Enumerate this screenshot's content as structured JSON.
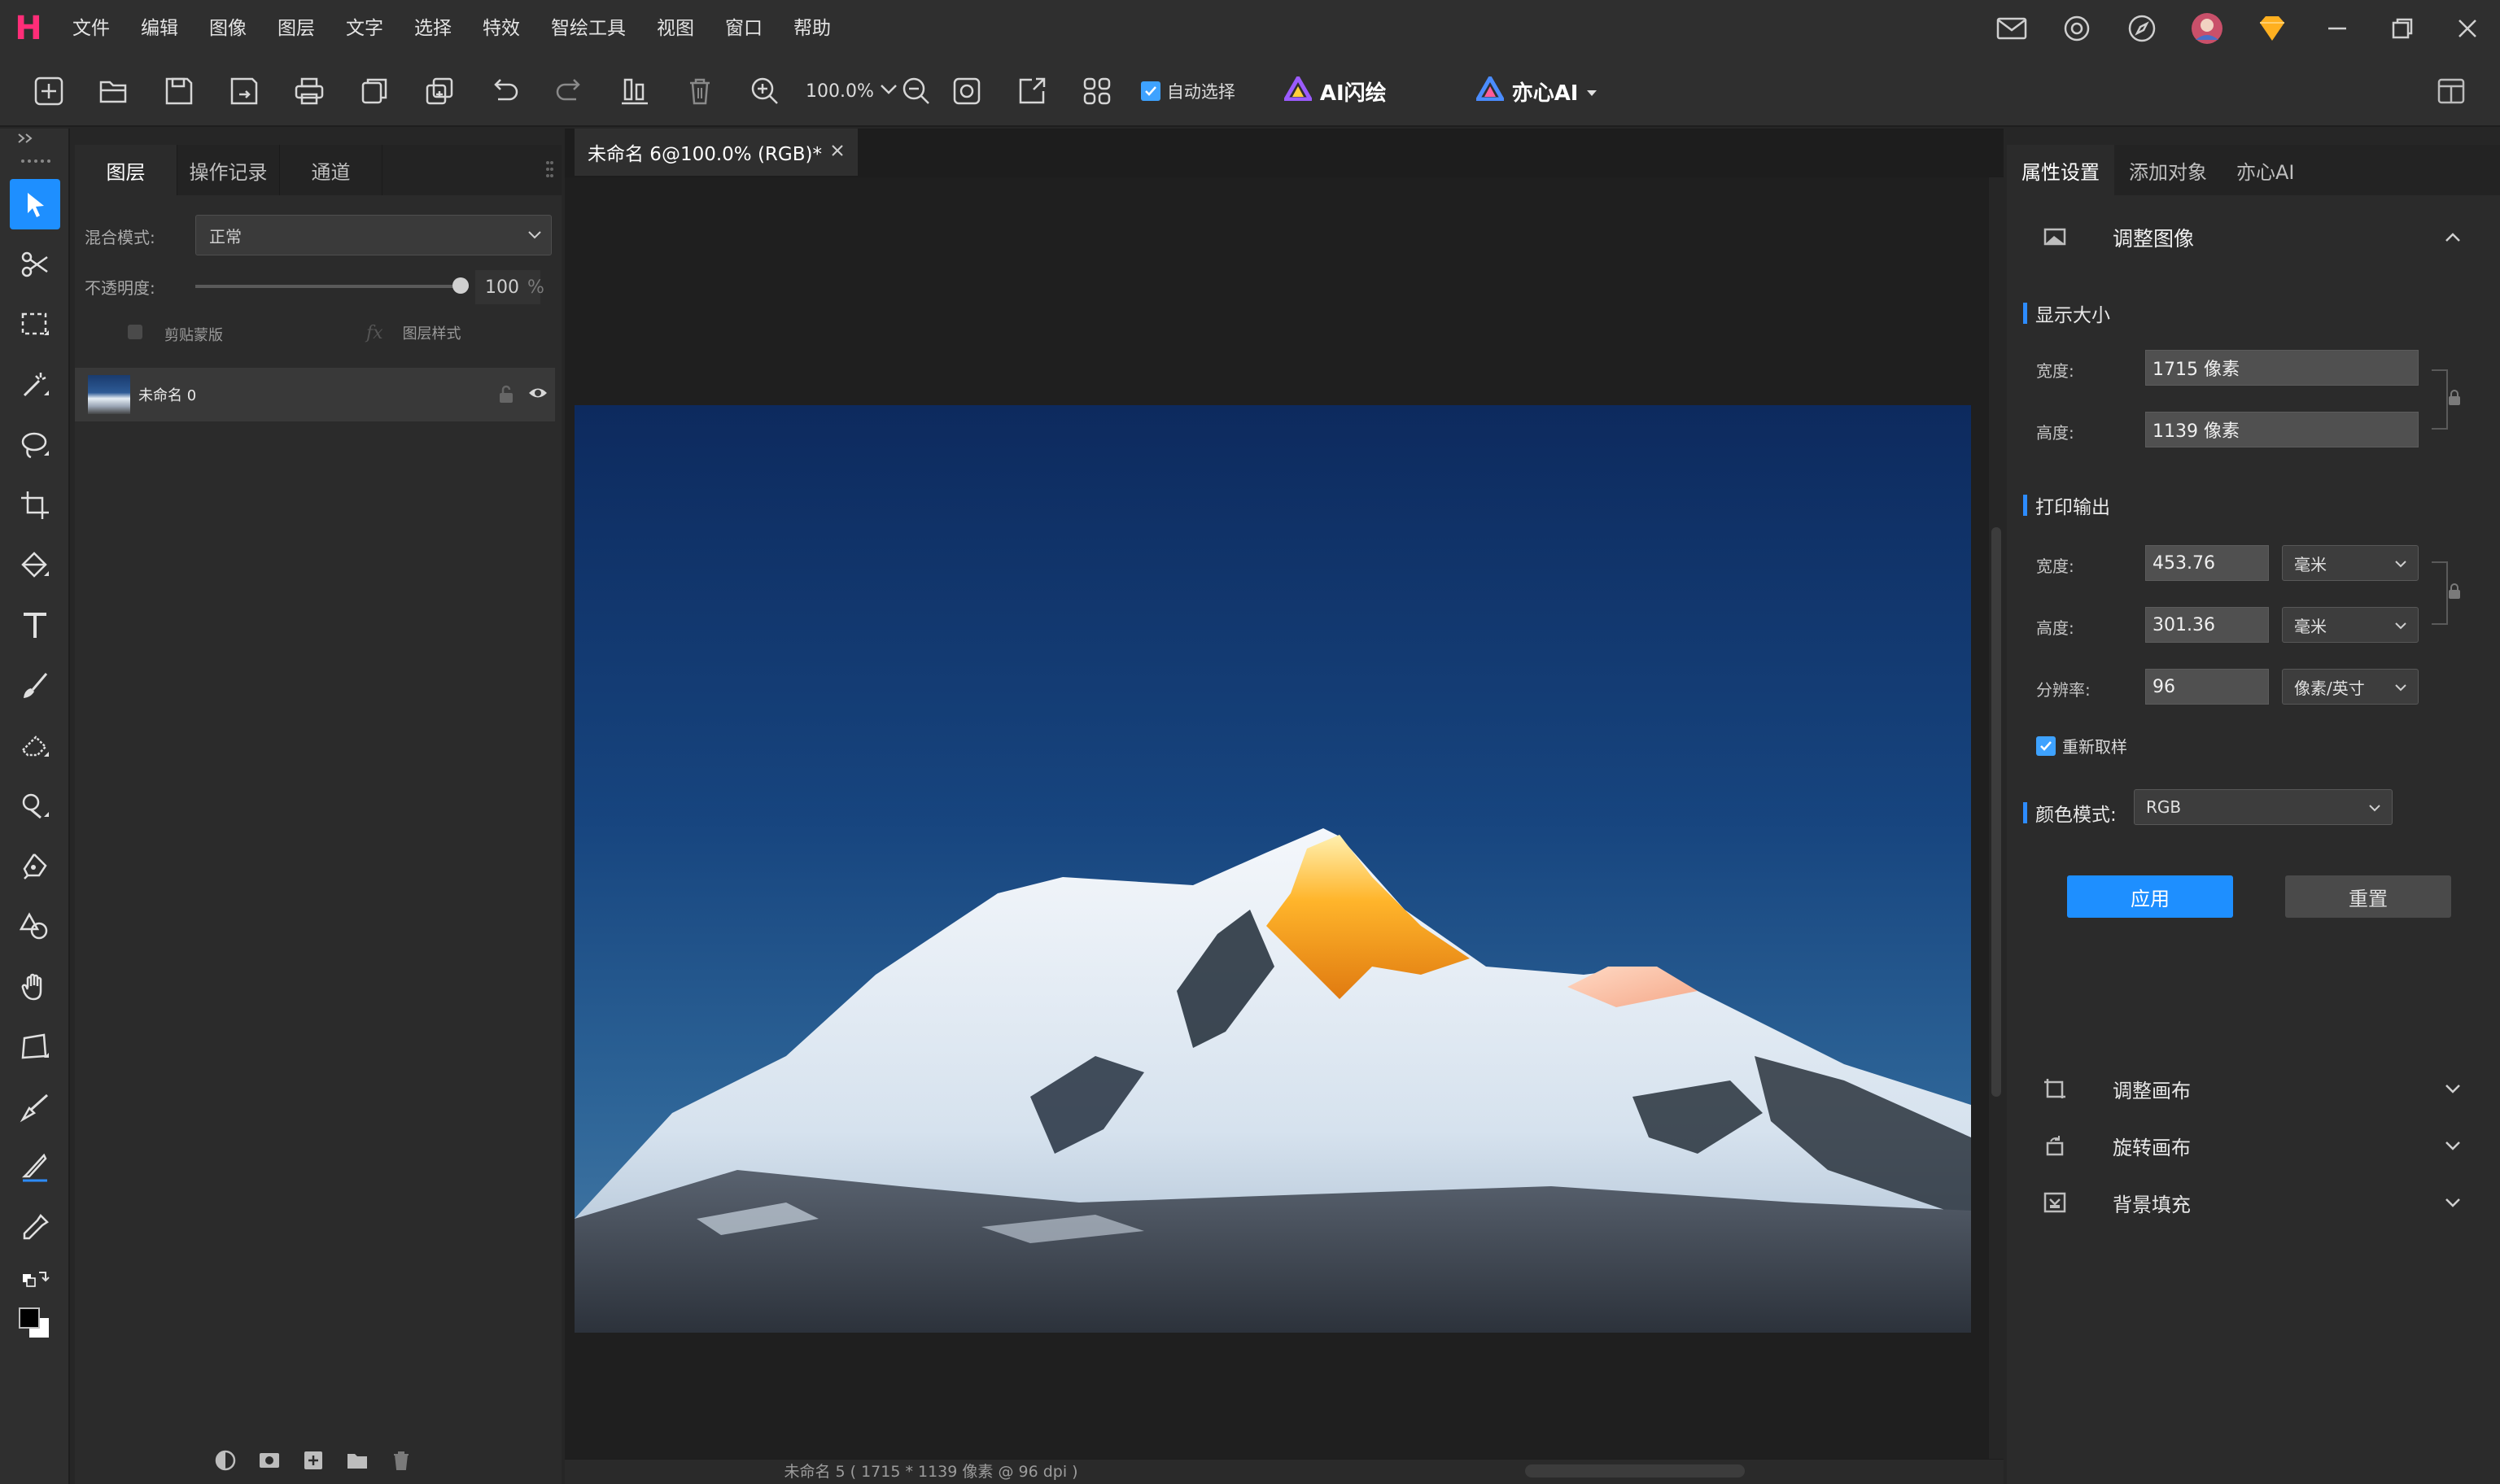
{
  "app": {
    "logo": "H"
  },
  "menu": [
    "文件",
    "编辑",
    "图像",
    "图层",
    "文字",
    "选择",
    "特效",
    "智绘工具",
    "视图",
    "窗口",
    "帮助"
  ],
  "toolbar": {
    "zoom": "100.0%",
    "auto_select": "自动选择",
    "ai_flash": "AI闪绘",
    "yixin_ai": "亦心AI"
  },
  "layers_panel": {
    "tabs": [
      "图层",
      "操作记录",
      "通道"
    ],
    "blend_label": "混合模式:",
    "blend_value": "正常",
    "opacity_label": "不透明度:",
    "opacity_value": "100",
    "opacity_unit": "%",
    "opacity_level": 1.0,
    "clip_mask": "剪贴蒙版",
    "layer_style": "图层样式",
    "layer_name": "未命名 0"
  },
  "document": {
    "tab_title": "未命名 6@100.0% (RGB)*",
    "status": "未命名 5 ( 1715 * 1139 像素 @ 96 dpi )"
  },
  "right_panel": {
    "tabs": [
      "属性设置",
      "添加对象",
      "亦心AI"
    ],
    "section_title": "调整图像",
    "display_size": {
      "title": "显示大小",
      "width_label": "宽度:",
      "width_value": "1715 像素",
      "height_label": "高度:",
      "height_value": "1139 像素"
    },
    "print_output": {
      "title": "打印输出",
      "width_label": "宽度:",
      "width_value": "453.76",
      "width_unit": "毫米",
      "height_label": "高度:",
      "height_value": "301.36",
      "height_unit": "毫米",
      "resolution_label": "分辨率:",
      "resolution_value": "96",
      "resolution_unit": "像素/英寸"
    },
    "resample_label": "重新取样",
    "color_mode_label": "颜色模式:",
    "color_mode_value": "RGB",
    "apply": "应用",
    "reset": "重置",
    "collapsed_sections": [
      "调整画布",
      "旋转画布",
      "背景填充"
    ]
  },
  "colors": {
    "accent": "#1e8fff",
    "logo": "#ff2d78"
  }
}
